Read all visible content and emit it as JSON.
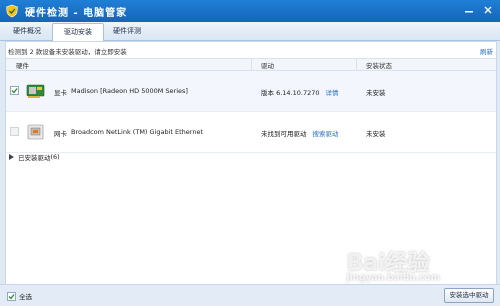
{
  "window": {
    "title": "硬件检测 - 电脑管家"
  },
  "tabs": [
    {
      "label": "硬件概况",
      "active": false
    },
    {
      "label": "驱动安装",
      "active": true
    },
    {
      "label": "硬件评测",
      "active": false
    }
  ],
  "main": {
    "info_prefix": "检测到",
    "info_count": "2",
    "info_suffix": "款设备未安装驱动，请立即安装",
    "refresh_label": "刷新",
    "columns": {
      "hardware": "硬件",
      "driver": "驱动",
      "status": "安装状态"
    },
    "devices": [
      {
        "checked": true,
        "type": "显卡",
        "name": "Madison [Radeon HD 5000M Series]",
        "driver_text": "版本 6.14.10.7270",
        "driver_link": "详情",
        "status": "未安装",
        "icon": "graphics-card-icon"
      },
      {
        "checked": false,
        "type": "网卡",
        "name": "Broadcom NetLink (TM) Gigabit Ethernet",
        "driver_text": "未找到可用驱动",
        "driver_link": "搜索驱动",
        "status": "未安装",
        "icon": "network-card-icon"
      }
    ],
    "installed_section": {
      "label": "已安装驱动",
      "count": "(6)"
    }
  },
  "bottom": {
    "select_all_label": "全选",
    "select_all_checked": true,
    "install_button": "安装选中驱动"
  },
  "watermark": {
    "text": "Bai经验",
    "sub": "jingyan.baidu.com"
  },
  "colors": {
    "title_bar": "#1665b9",
    "link": "#2a6fbe",
    "accent_check": "#2f8a2f"
  }
}
